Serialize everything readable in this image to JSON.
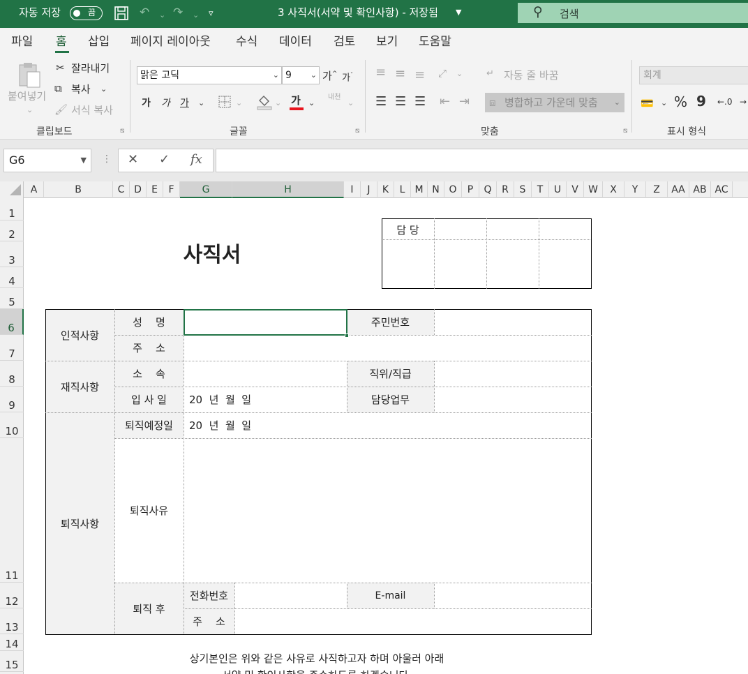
{
  "titlebar": {
    "autosave_label": "자동 저장",
    "autosave_state": "끔",
    "doc_title": "3 사직서(서약 및 확인사항) - 저장됨",
    "search_placeholder": "검색"
  },
  "menu": {
    "tabs": [
      {
        "label": "파일"
      },
      {
        "label": "홈",
        "active": true
      },
      {
        "label": "삽입"
      },
      {
        "label": "페이지 레이아웃"
      },
      {
        "label": "수식"
      },
      {
        "label": "데이터"
      },
      {
        "label": "검토"
      },
      {
        "label": "보기"
      },
      {
        "label": "도움말"
      }
    ]
  },
  "ribbon": {
    "clipboard": {
      "paste": "붙여넣기",
      "cut": "잘라내기",
      "copy": "복사",
      "format_painter": "서식 복사",
      "group": "클립보드"
    },
    "font": {
      "font_name": "맑은 고딕",
      "font_size": "9",
      "grow": "가",
      "shrink": "가",
      "bold": "가",
      "italic": "가",
      "underline": "가",
      "font_color_glyph": "가",
      "phonetic": "내천",
      "group": "글꼴"
    },
    "alignment": {
      "wrap_text": "자동 줄 바꿈",
      "merge_center": "병합하고 가운데 맞춤",
      "group": "맞춤"
    },
    "number": {
      "format": "회계",
      "percent": "%",
      "comma": "9",
      "group": "표시 형식"
    }
  },
  "formula_bar": {
    "name_box": "G6",
    "cancel": "✕",
    "enter": "✓",
    "fx": "fx",
    "formula": ""
  },
  "grid": {
    "columns": [
      "A",
      "B",
      "C",
      "D",
      "E",
      "F",
      "G",
      "H",
      "I",
      "J",
      "K",
      "L",
      "M",
      "N",
      "O",
      "P",
      "Q",
      "R",
      "S",
      "T",
      "U",
      "V",
      "W",
      "X",
      "Y",
      "Z",
      "AA",
      "AB",
      "AC"
    ],
    "selected_column": "G",
    "rows": [
      "1",
      "2",
      "3",
      "4",
      "5",
      "6",
      "7",
      "8",
      "9",
      "10",
      "11",
      "12",
      "13",
      "14",
      "15"
    ],
    "selected_row": "6"
  },
  "form": {
    "title": "사직서",
    "approval_header": "담 당",
    "sec_personal": "인적사항",
    "label_name": "성    명",
    "label_rrn": "주민번호",
    "label_address": "주    소",
    "sec_employment": "재직사항",
    "label_dept": "소    속",
    "label_position": "직위/직급",
    "label_hire_date": "입 사 일",
    "hire_date_value": "20  년  월  일",
    "label_duty": "담당업무",
    "sec_resignation": "퇴직사항",
    "label_resign_date": "퇴직예정일",
    "resign_date_value": "20  년  월  일",
    "label_reason": "퇴직사유",
    "label_after": "퇴직 후",
    "label_phone": "전화번호",
    "label_email": "E-mail",
    "label_address2": "주    소",
    "statement_line1": "상기본인은 위와 같은 사유로 사직하고자 하며 아울러 아래",
    "statement_line2": "서약 및 확인사항을 준수하도록 하겠습니다."
  }
}
